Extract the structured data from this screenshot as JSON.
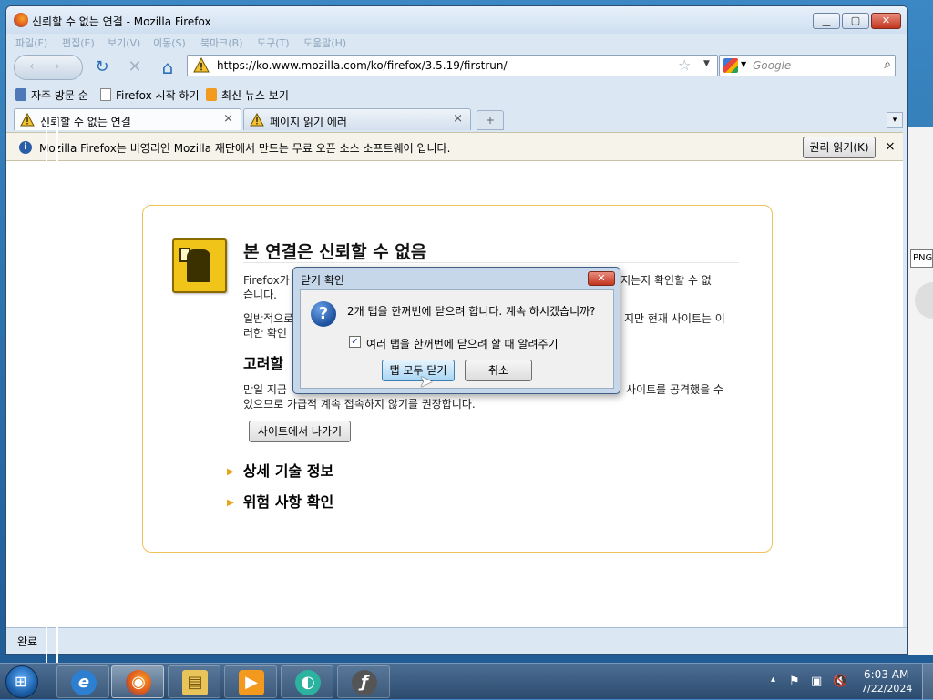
{
  "window": {
    "title": "신뢰할 수 없는 연결 - Mozilla Firefox",
    "controls": {
      "minimize": "▁",
      "maximize": "▢",
      "close": "✕"
    }
  },
  "menubar": {
    "items": [
      "파일(F)",
      "편집(E)",
      "보기(V)",
      "이동(S)",
      "북마크(B)",
      "도구(T)",
      "도움말(H)"
    ]
  },
  "navbar": {
    "back_label": "‹",
    "forward_label": "›",
    "reload_glyph": "↻",
    "stop_glyph": "✕",
    "home_glyph": "⌂",
    "url": "https://ko.www.mozilla.com/ko/firefox/3.5.19/firstrun/",
    "search_placeholder": "Google"
  },
  "bookmarks": {
    "items": [
      "자주 방문 순",
      "Firefox 시작 하기",
      "최신 뉴스 보기"
    ]
  },
  "tabs": [
    {
      "label": "신뢰할 수 없는 연결",
      "active": true
    },
    {
      "label": "페이지 읽기 에러",
      "active": false
    }
  ],
  "tab_close_glyph": "×",
  "newtab_glyph": "+",
  "notification": {
    "text": "Mozilla Firefox는 비영리인 Mozilla 재단에서 만드는 무료 오픈 소스 소프트웨어 입니다.",
    "button": "권리 읽기(K)",
    "close_glyph": "×"
  },
  "error_page": {
    "title": "본 연결은 신뢰할 수 없음",
    "para1_start": "Firefox가 보",
    "para1_end": "루어지는지 확인할 수 없",
    "para1_line2": "습니다.",
    "para2_start": "일반적으로",
    "para2_end": "지만 현재 사이트는 이",
    "para2_line2": "러한 확인",
    "heading": "고려할",
    "para3_start": "만일 지금",
    "para3_end": "사이트를 공격했을 수",
    "para3_line2": "있으므로 가급적 계속 접속하지 않기를 권장합니다.",
    "exit_button": "사이트에서 나가기",
    "expander1": "상세 기술 정보",
    "expander2": "위험 사항 확인"
  },
  "status": {
    "text": "완료"
  },
  "dialog": {
    "title": "닫기 확인",
    "close_glyph": "✕",
    "question_glyph": "?",
    "message": "2개 탭을 한꺼번에 닫으려 합니다. 계속 하시겠습니까?",
    "checkbox_label": "여러 탭을 한꺼번에 닫으려 할 때 알려주기",
    "checkbox_checked": true,
    "checkbox_glyph": "✓",
    "primary_button": "탭 모두 닫기",
    "secondary_button": "취소"
  },
  "desktop": {
    "field_text": "PNG"
  },
  "taskbar": {
    "start_glyph": "⊞",
    "apps": [
      "internet-explorer",
      "firefox",
      "file-explorer",
      "media-player",
      "messenger",
      "flash"
    ],
    "app_glyphs": [
      "e",
      "◉",
      "▤",
      "▶",
      "◐",
      "ƒ"
    ],
    "tray_glyphs": [
      "▴",
      "⚑",
      "▣",
      "🔇"
    ],
    "clock_time": "6:03 AM",
    "clock_date": "7/22/2024"
  },
  "colors": {
    "accent": "#3c7fb1",
    "error_border": "#f0c35a",
    "expander_arrow": "#e8a416"
  }
}
